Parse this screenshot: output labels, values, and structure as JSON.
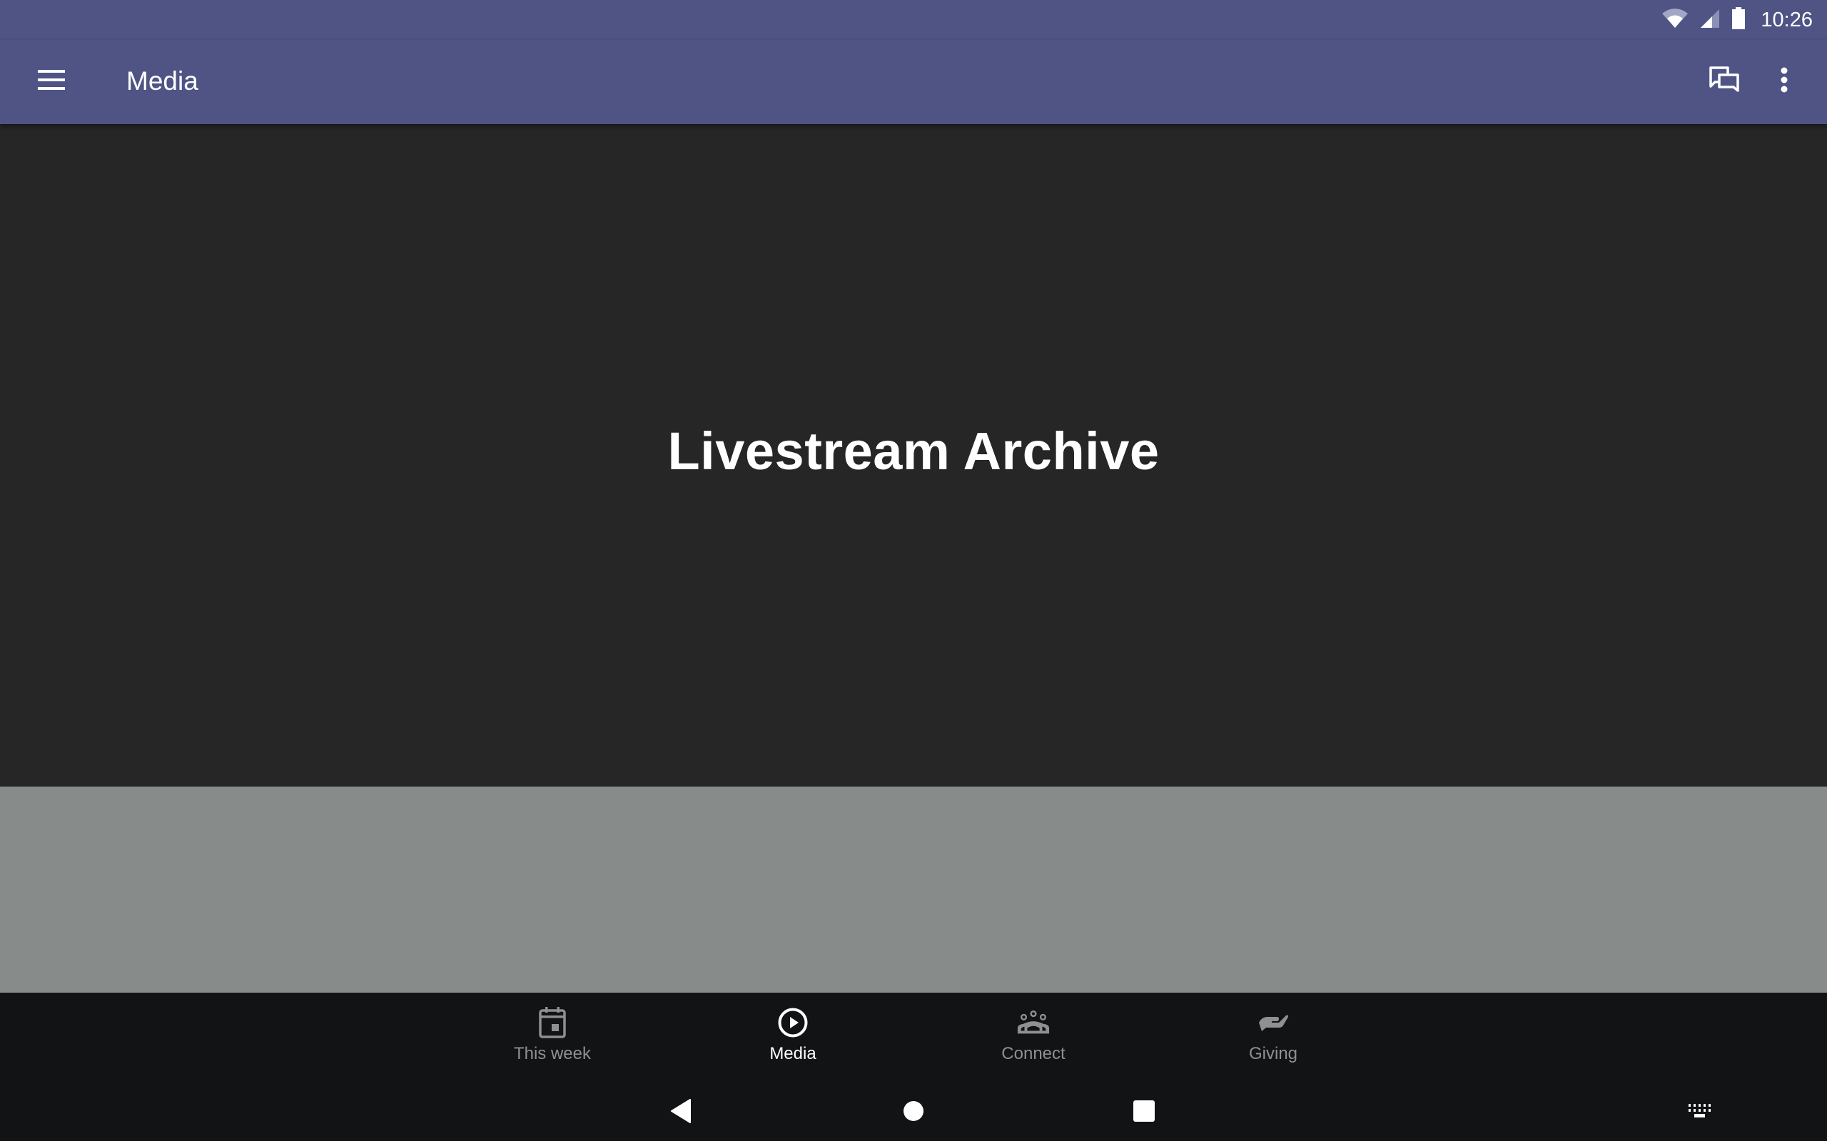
{
  "status_bar": {
    "time": "10:26",
    "icons": [
      "wifi-icon",
      "cell-signal-icon",
      "battery-icon"
    ]
  },
  "toolbar": {
    "title": "Media",
    "menu_icon": "hamburger-menu-icon",
    "actions": [
      "chat-icon",
      "more-vert-icon"
    ]
  },
  "hero": {
    "title": "Livestream Archive"
  },
  "bottom_nav": {
    "active": "Media",
    "items": [
      {
        "label": "This week",
        "icon": "calendar-icon"
      },
      {
        "label": "Media",
        "icon": "play-circle-icon"
      },
      {
        "label": "Connect",
        "icon": "group-icon"
      },
      {
        "label": "Giving",
        "icon": "giving-hand-icon"
      }
    ]
  },
  "system_nav": {
    "buttons": [
      "back-icon",
      "home-icon",
      "recents-icon",
      "keyboard-icon"
    ]
  },
  "colors": {
    "primary": "#4f5485",
    "hero_bg": "#262626",
    "panel_bg": "#878c8b",
    "nav_bg": "#121315",
    "nav_inactive": "#8f9092",
    "nav_active": "#ffffff"
  }
}
